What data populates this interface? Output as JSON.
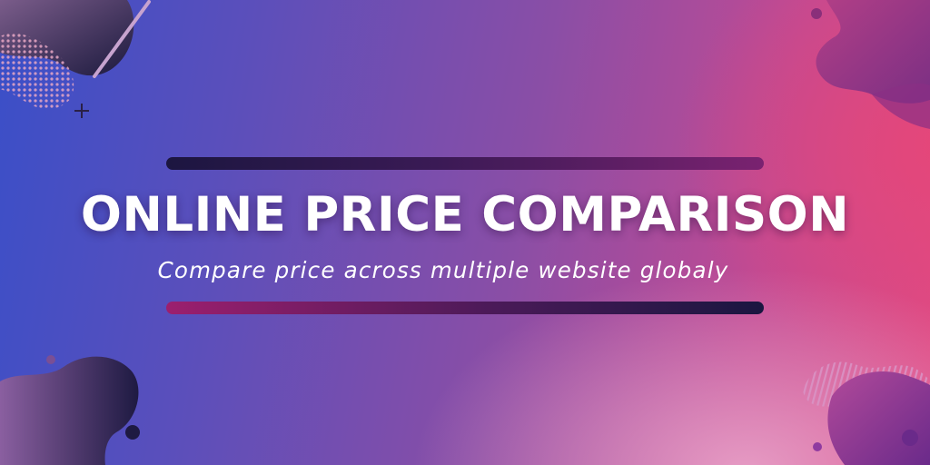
{
  "banner": {
    "title": "ONLINE PRICE COMPARISON",
    "subtitle": "Compare price across multiple website globaly"
  },
  "colors": {
    "background_left": "#3a4fc8",
    "background_mid": "#8a4ea6",
    "background_right": "#e04a83",
    "text": "#ffffff",
    "bar_dark": "#1c1640",
    "bar_magenta": "#9c1f6e"
  }
}
